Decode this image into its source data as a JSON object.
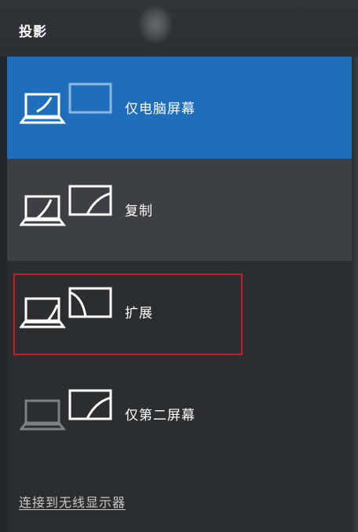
{
  "panel": {
    "title": "投影"
  },
  "options": [
    {
      "label": "仅电脑屏幕",
      "selected": true
    },
    {
      "label": "复制",
      "hovered": true
    },
    {
      "label": "扩展",
      "highlighted": true
    },
    {
      "label": "仅第二屏幕"
    }
  ],
  "footer": {
    "wireless_link": "连接到无线显示器"
  },
  "colors": {
    "panel_bg": "#2b2e31",
    "selected_bg": "#1f6ebc",
    "hover_bg": "#3c3f43",
    "highlight_border": "#c41e25"
  }
}
